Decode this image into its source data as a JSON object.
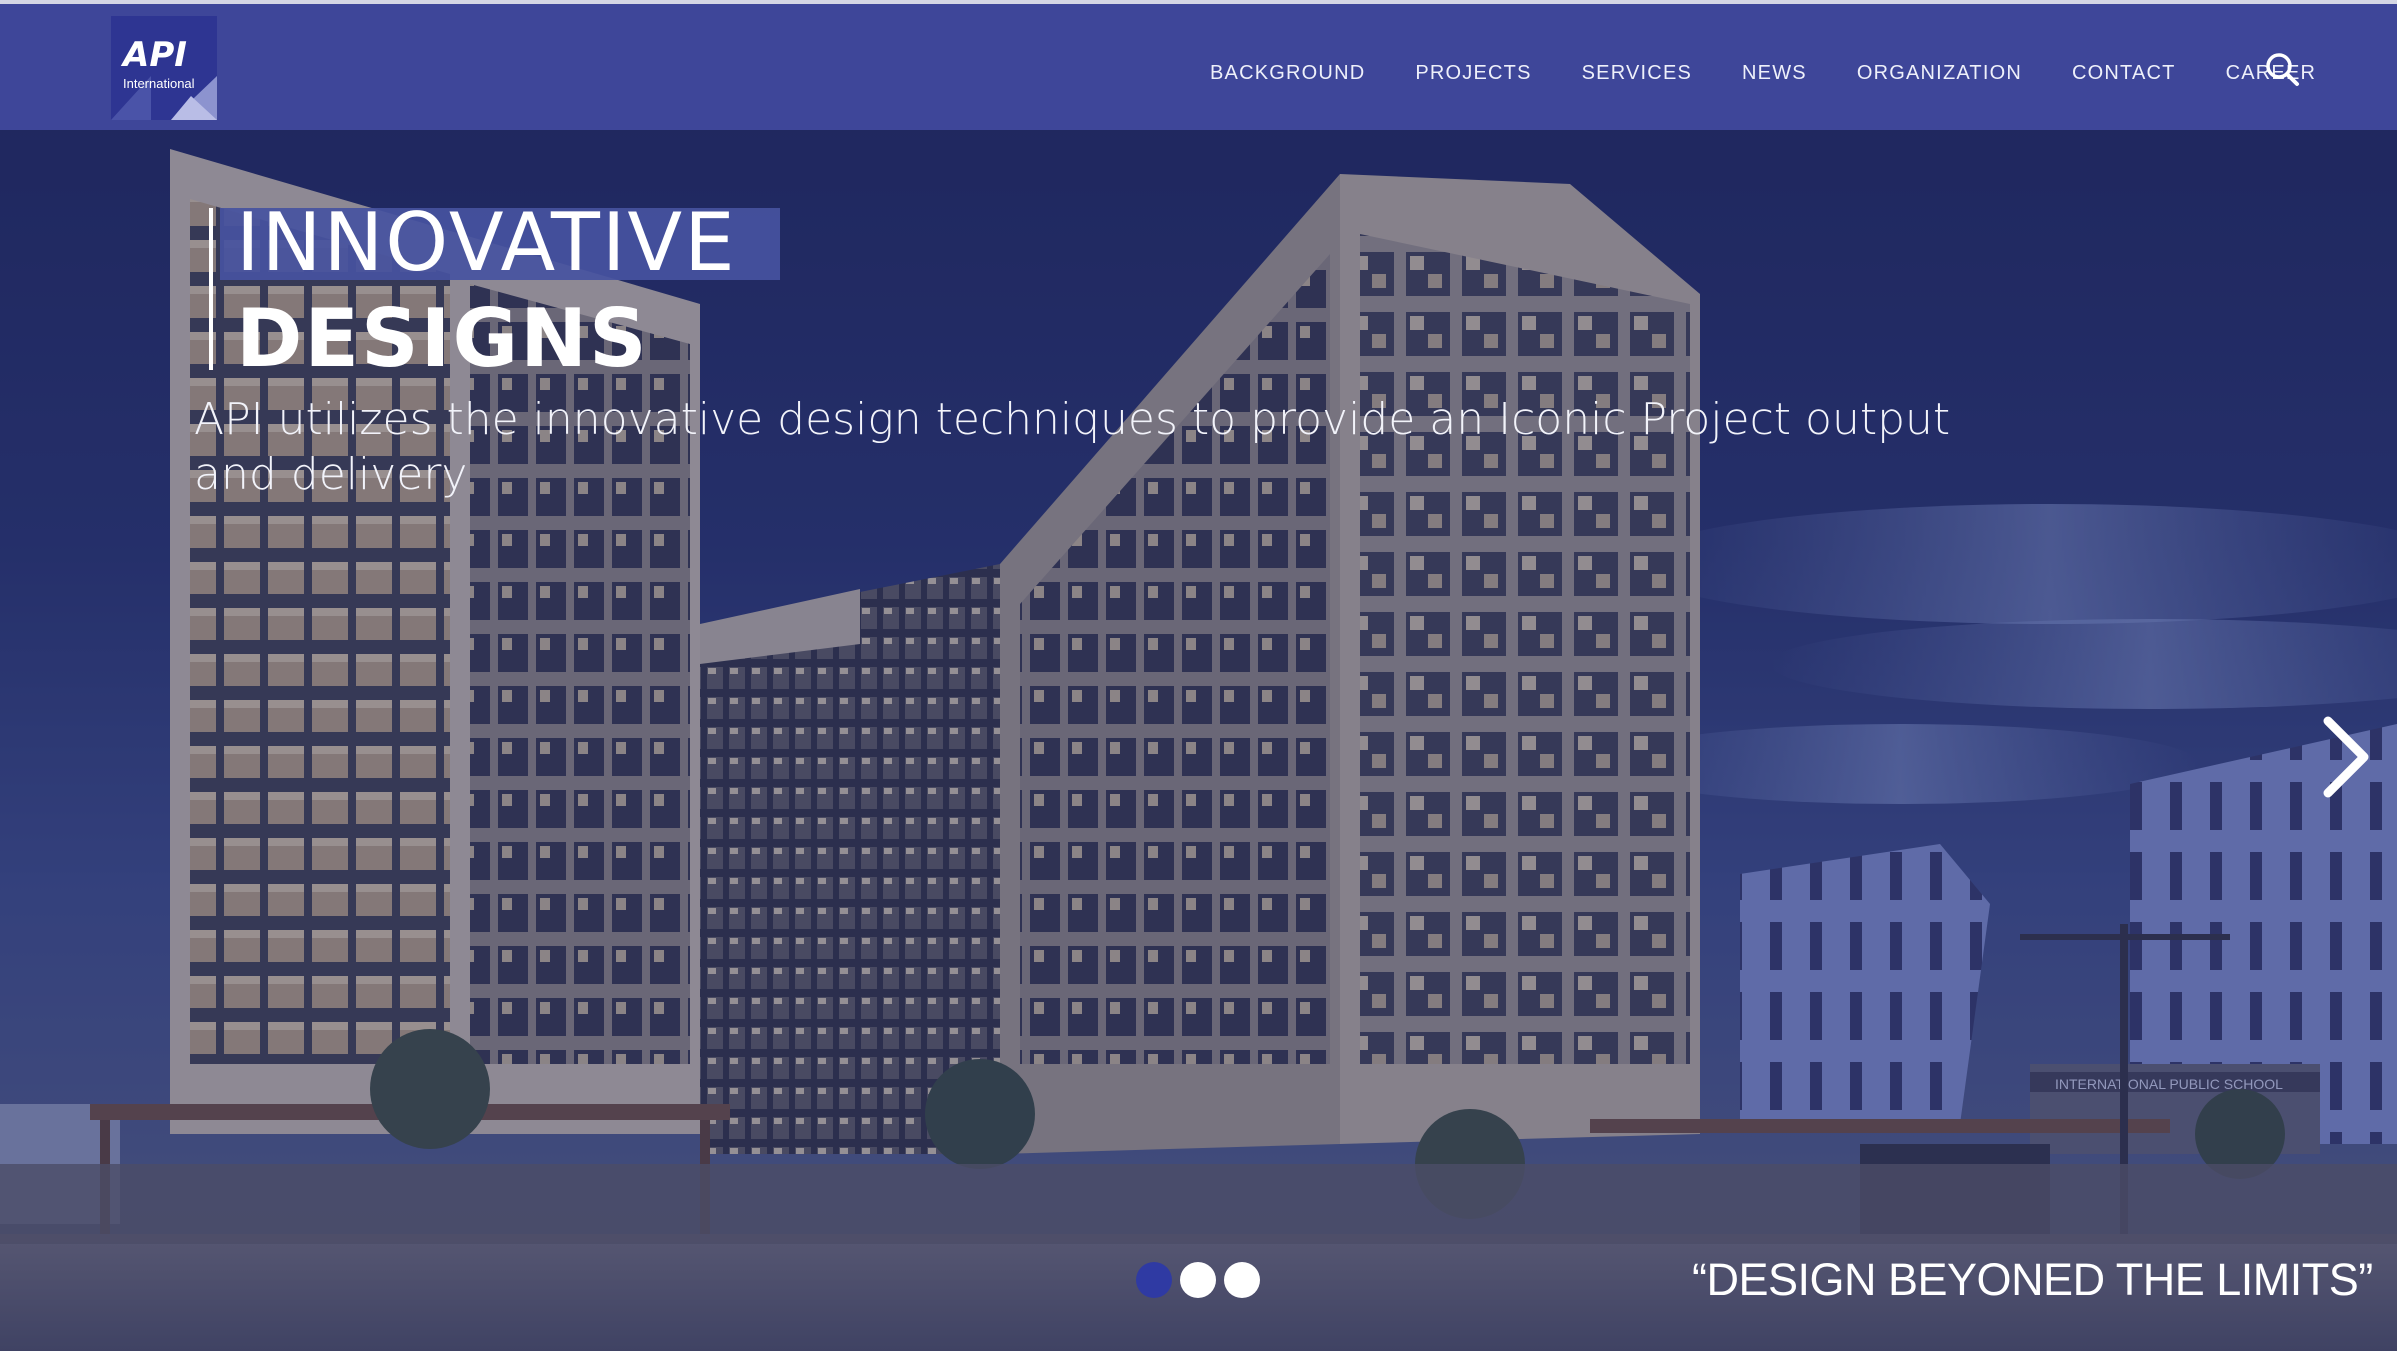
{
  "brand": {
    "logo_text": "API",
    "logo_subtext": "International",
    "primary_color": "#3e4699",
    "accent_color": "#2f3aa3"
  },
  "nav": {
    "items": [
      {
        "label": "BACKGROUND"
      },
      {
        "label": "PROJECTS"
      },
      {
        "label": "SERVICES"
      },
      {
        "label": "NEWS"
      },
      {
        "label": "ORGANIZATION"
      },
      {
        "label": "CONTACT"
      },
      {
        "label": "CAREER"
      }
    ],
    "search_icon": "search-icon"
  },
  "hero": {
    "title_line1": "INNOVATIVE",
    "title_line2": "DESIGNS",
    "subtitle": "API utilizes the innovative design techniques to provide an Iconic Project output and delivery",
    "tagline": "“DESIGN BEYONED THE LIMITS”",
    "next_icon": "chevron-right-icon",
    "slides": {
      "total": 3,
      "active": 1
    },
    "school_sign": "INTERNATIONAL PUBLIC SCHOOL"
  }
}
